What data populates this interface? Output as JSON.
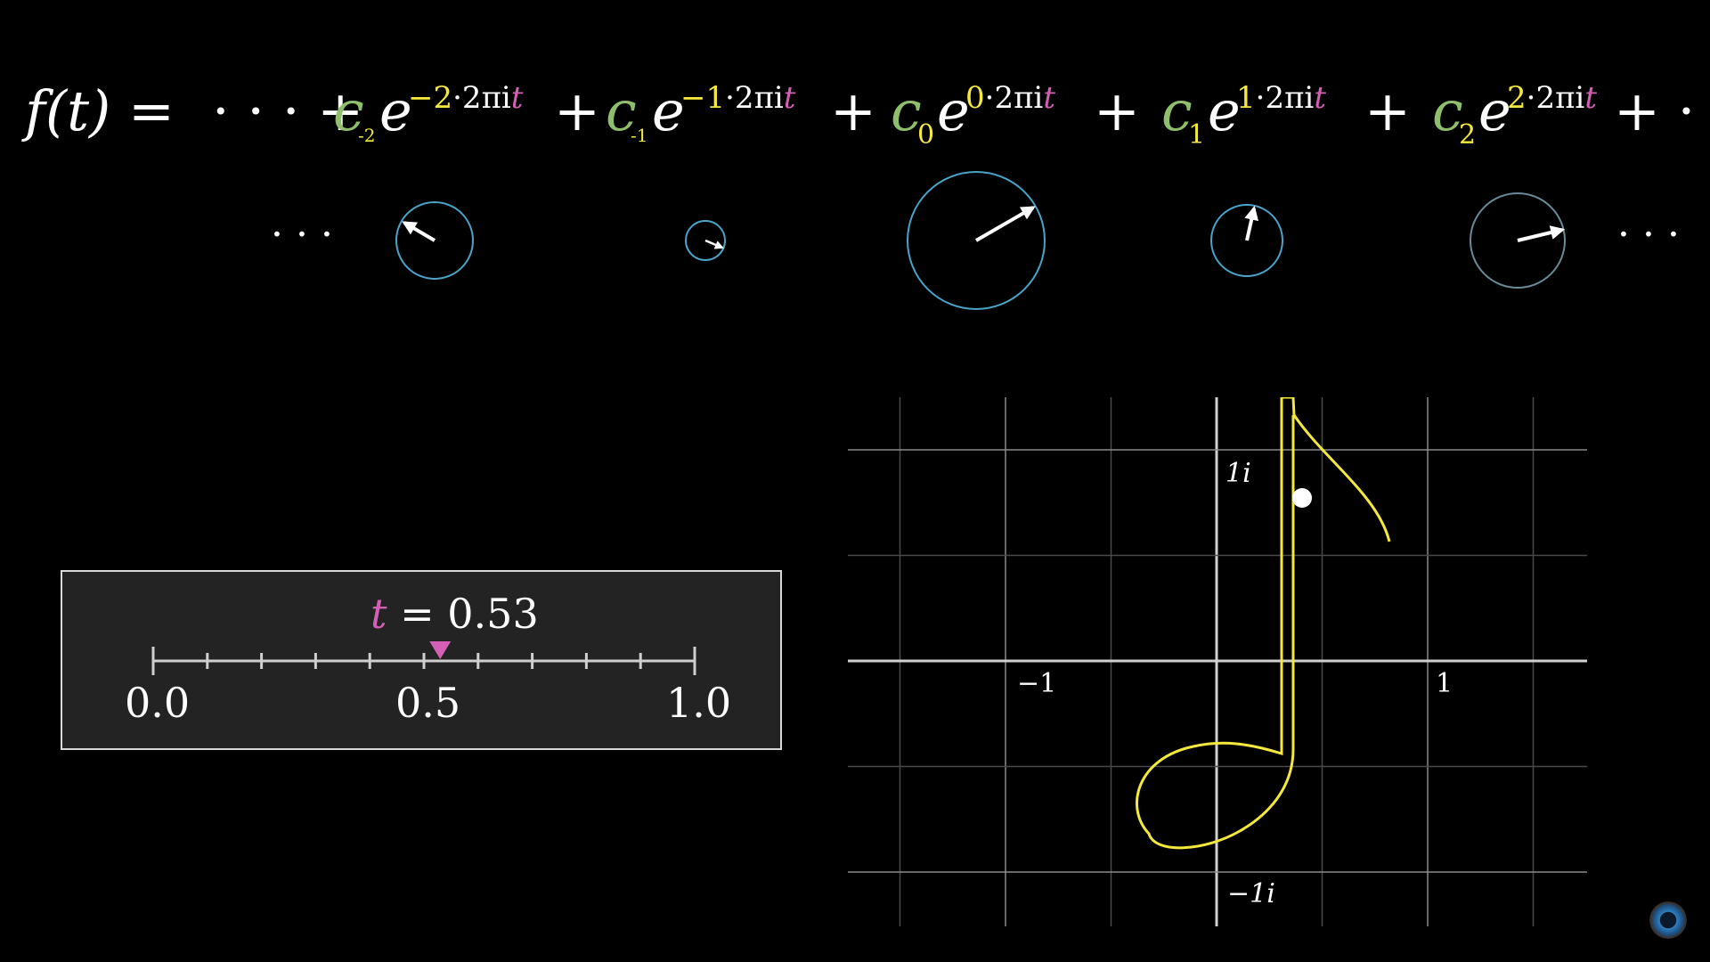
{
  "equation": {
    "lhs": "f(t) =",
    "lead": "· · · +",
    "tail": "+ · ·",
    "plus": "+",
    "terms": [
      {
        "coef": "c",
        "sub": "-2",
        "base": "e",
        "k": "−2",
        "rest": "·2πi",
        "t": "t"
      },
      {
        "coef": "c",
        "sub": "-1",
        "base": "e",
        "k": "−1",
        "rest": "·2πi",
        "t": "t"
      },
      {
        "coef": "c",
        "sub": "0",
        "base": "e",
        "k": "0",
        "rest": "·2πi",
        "t": "t"
      },
      {
        "coef": "c",
        "sub": "1",
        "base": "e",
        "k": "1",
        "rest": "·2πi",
        "t": "t"
      },
      {
        "coef": "c",
        "sub": "2",
        "base": "e",
        "k": "2",
        "rest": "·2πi",
        "t": "t"
      }
    ]
  },
  "phasors": {
    "ellipsis_left": "· · ·",
    "ellipsis_right": "· · ·",
    "circle_color": "#4aa3c8",
    "arrow_color": "#ffffff"
  },
  "slider": {
    "var": "t",
    "equals": "= 0.53",
    "value": 0.53,
    "min_label": "0.0",
    "mid_label": "0.5",
    "max_label": "1.0",
    "marker_color": "#d35fb7"
  },
  "plane": {
    "label_pos_i": "1i",
    "label_neg_i": "−1i",
    "label_neg_1": "−1",
    "label_pos_1": "1",
    "curve_color": "#f5e83c"
  },
  "colors": {
    "coef": "#8fbf6a",
    "freq": "#f5e83c",
    "time": "#d35fb7"
  }
}
